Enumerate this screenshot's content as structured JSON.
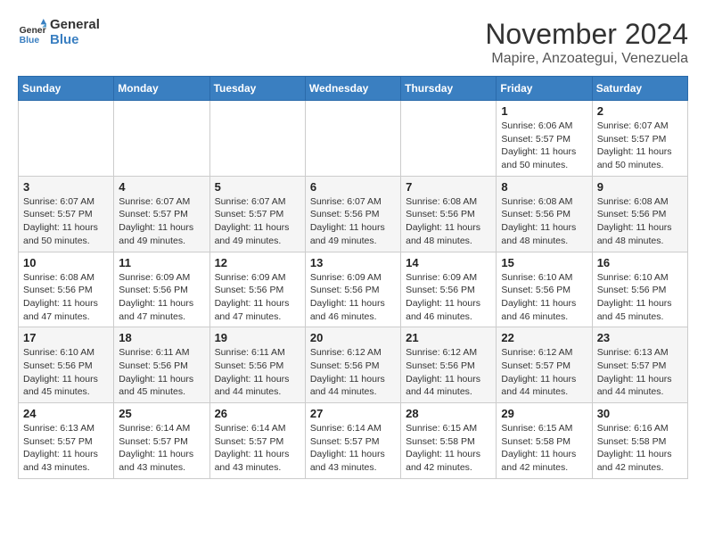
{
  "logo": {
    "line1": "General",
    "line2": "Blue"
  },
  "title": "November 2024",
  "subtitle": "Mapire, Anzoategui, Venezuela",
  "weekdays": [
    "Sunday",
    "Monday",
    "Tuesday",
    "Wednesday",
    "Thursday",
    "Friday",
    "Saturday"
  ],
  "weeks": [
    [
      {
        "day": "",
        "info": ""
      },
      {
        "day": "",
        "info": ""
      },
      {
        "day": "",
        "info": ""
      },
      {
        "day": "",
        "info": ""
      },
      {
        "day": "",
        "info": ""
      },
      {
        "day": "1",
        "info": "Sunrise: 6:06 AM\nSunset: 5:57 PM\nDaylight: 11 hours\nand 50 minutes."
      },
      {
        "day": "2",
        "info": "Sunrise: 6:07 AM\nSunset: 5:57 PM\nDaylight: 11 hours\nand 50 minutes."
      }
    ],
    [
      {
        "day": "3",
        "info": "Sunrise: 6:07 AM\nSunset: 5:57 PM\nDaylight: 11 hours\nand 50 minutes."
      },
      {
        "day": "4",
        "info": "Sunrise: 6:07 AM\nSunset: 5:57 PM\nDaylight: 11 hours\nand 49 minutes."
      },
      {
        "day": "5",
        "info": "Sunrise: 6:07 AM\nSunset: 5:57 PM\nDaylight: 11 hours\nand 49 minutes."
      },
      {
        "day": "6",
        "info": "Sunrise: 6:07 AM\nSunset: 5:56 PM\nDaylight: 11 hours\nand 49 minutes."
      },
      {
        "day": "7",
        "info": "Sunrise: 6:08 AM\nSunset: 5:56 PM\nDaylight: 11 hours\nand 48 minutes."
      },
      {
        "day": "8",
        "info": "Sunrise: 6:08 AM\nSunset: 5:56 PM\nDaylight: 11 hours\nand 48 minutes."
      },
      {
        "day": "9",
        "info": "Sunrise: 6:08 AM\nSunset: 5:56 PM\nDaylight: 11 hours\nand 48 minutes."
      }
    ],
    [
      {
        "day": "10",
        "info": "Sunrise: 6:08 AM\nSunset: 5:56 PM\nDaylight: 11 hours\nand 47 minutes."
      },
      {
        "day": "11",
        "info": "Sunrise: 6:09 AM\nSunset: 5:56 PM\nDaylight: 11 hours\nand 47 minutes."
      },
      {
        "day": "12",
        "info": "Sunrise: 6:09 AM\nSunset: 5:56 PM\nDaylight: 11 hours\nand 47 minutes."
      },
      {
        "day": "13",
        "info": "Sunrise: 6:09 AM\nSunset: 5:56 PM\nDaylight: 11 hours\nand 46 minutes."
      },
      {
        "day": "14",
        "info": "Sunrise: 6:09 AM\nSunset: 5:56 PM\nDaylight: 11 hours\nand 46 minutes."
      },
      {
        "day": "15",
        "info": "Sunrise: 6:10 AM\nSunset: 5:56 PM\nDaylight: 11 hours\nand 46 minutes."
      },
      {
        "day": "16",
        "info": "Sunrise: 6:10 AM\nSunset: 5:56 PM\nDaylight: 11 hours\nand 45 minutes."
      }
    ],
    [
      {
        "day": "17",
        "info": "Sunrise: 6:10 AM\nSunset: 5:56 PM\nDaylight: 11 hours\nand 45 minutes."
      },
      {
        "day": "18",
        "info": "Sunrise: 6:11 AM\nSunset: 5:56 PM\nDaylight: 11 hours\nand 45 minutes."
      },
      {
        "day": "19",
        "info": "Sunrise: 6:11 AM\nSunset: 5:56 PM\nDaylight: 11 hours\nand 44 minutes."
      },
      {
        "day": "20",
        "info": "Sunrise: 6:12 AM\nSunset: 5:56 PM\nDaylight: 11 hours\nand 44 minutes."
      },
      {
        "day": "21",
        "info": "Sunrise: 6:12 AM\nSunset: 5:56 PM\nDaylight: 11 hours\nand 44 minutes."
      },
      {
        "day": "22",
        "info": "Sunrise: 6:12 AM\nSunset: 5:57 PM\nDaylight: 11 hours\nand 44 minutes."
      },
      {
        "day": "23",
        "info": "Sunrise: 6:13 AM\nSunset: 5:57 PM\nDaylight: 11 hours\nand 44 minutes."
      }
    ],
    [
      {
        "day": "24",
        "info": "Sunrise: 6:13 AM\nSunset: 5:57 PM\nDaylight: 11 hours\nand 43 minutes."
      },
      {
        "day": "25",
        "info": "Sunrise: 6:14 AM\nSunset: 5:57 PM\nDaylight: 11 hours\nand 43 minutes."
      },
      {
        "day": "26",
        "info": "Sunrise: 6:14 AM\nSunset: 5:57 PM\nDaylight: 11 hours\nand 43 minutes."
      },
      {
        "day": "27",
        "info": "Sunrise: 6:14 AM\nSunset: 5:57 PM\nDaylight: 11 hours\nand 43 minutes."
      },
      {
        "day": "28",
        "info": "Sunrise: 6:15 AM\nSunset: 5:58 PM\nDaylight: 11 hours\nand 42 minutes."
      },
      {
        "day": "29",
        "info": "Sunrise: 6:15 AM\nSunset: 5:58 PM\nDaylight: 11 hours\nand 42 minutes."
      },
      {
        "day": "30",
        "info": "Sunrise: 6:16 AM\nSunset: 5:58 PM\nDaylight: 11 hours\nand 42 minutes."
      }
    ]
  ]
}
